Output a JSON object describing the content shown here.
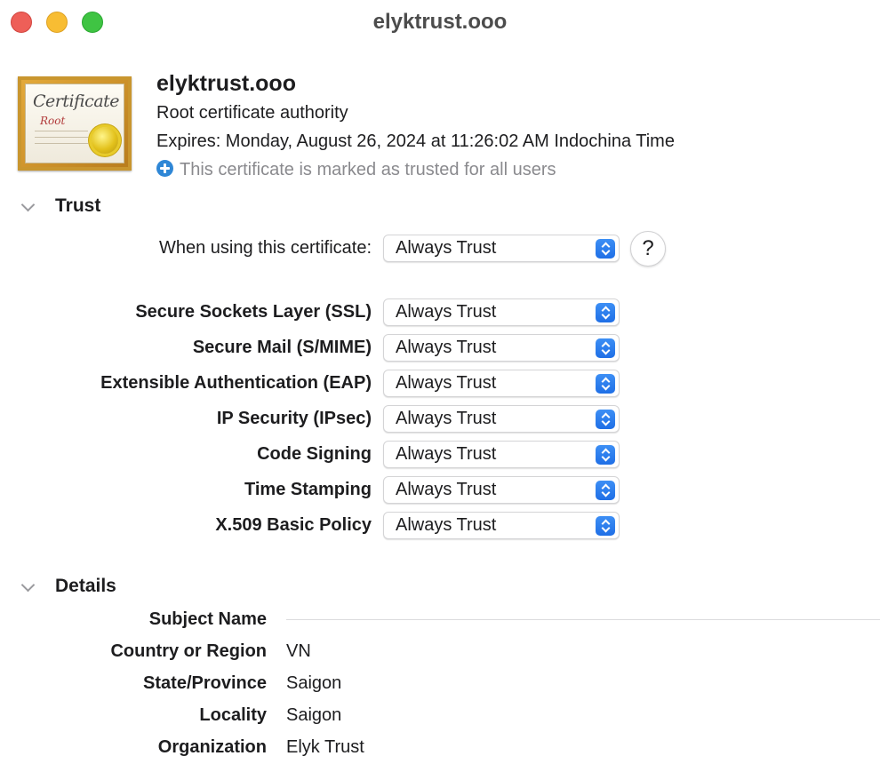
{
  "window": {
    "title": "elyktrust.ooo"
  },
  "certificate": {
    "icon_script": "Certificate",
    "icon_sub": "Root",
    "name": "elyktrust.ooo",
    "type": "Root certificate authority",
    "expires": "Expires: Monday, August 26, 2024 at 11:26:02 AM Indochina Time",
    "trusted_note": "This certificate is marked as trusted for all users"
  },
  "trust": {
    "section_title": "Trust",
    "when_using_label": "When using this certificate:",
    "when_using_value": "Always Trust",
    "help_label": "?",
    "policies": [
      {
        "label": "Secure Sockets Layer (SSL)",
        "value": "Always Trust"
      },
      {
        "label": "Secure Mail (S/MIME)",
        "value": "Always Trust"
      },
      {
        "label": "Extensible Authentication (EAP)",
        "value": "Always Trust"
      },
      {
        "label": "IP Security (IPsec)",
        "value": "Always Trust"
      },
      {
        "label": "Code Signing",
        "value": "Always Trust"
      },
      {
        "label": "Time Stamping",
        "value": "Always Trust"
      },
      {
        "label": "X.509 Basic Policy",
        "value": "Always Trust"
      }
    ]
  },
  "details": {
    "section_title": "Details",
    "subject_name_label": "Subject Name",
    "rows": [
      {
        "label": "Country or Region",
        "value": "VN"
      },
      {
        "label": "State/Province",
        "value": "Saigon"
      },
      {
        "label": "Locality",
        "value": "Saigon"
      },
      {
        "label": "Organization",
        "value": "Elyk Trust"
      }
    ]
  },
  "colors": {
    "accent": "#1f6fe6",
    "trusted_icon": "#2f87d6",
    "close": "#ee5f58",
    "minimize": "#f8bd33",
    "maximize": "#3fc443"
  }
}
